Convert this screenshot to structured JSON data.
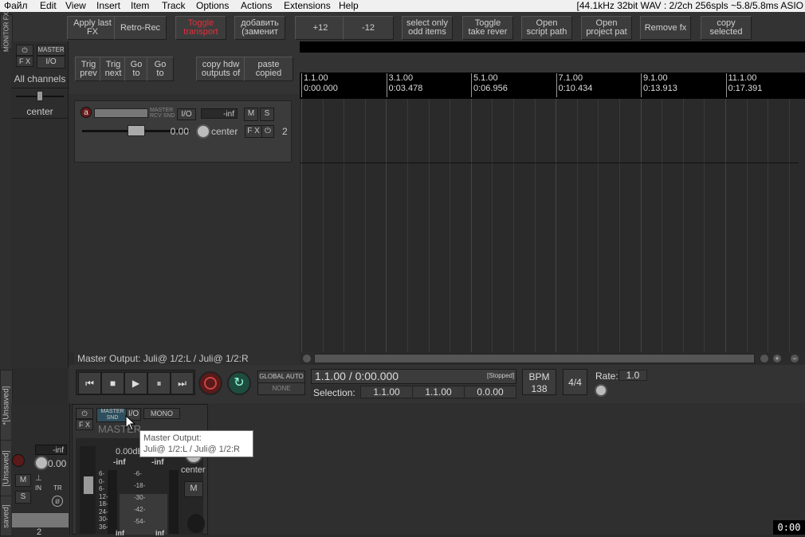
{
  "menu": {
    "items": [
      "Файл",
      "Edit",
      "View",
      "Insert",
      "Item",
      "Track",
      "Options",
      "Actions",
      "Extensions",
      "Help"
    ],
    "status": "[44.1kHz 32bit WAV : 2/2ch 256spls ~5.8/5.8ms ASIO"
  },
  "toolbar": {
    "row1": [
      {
        "name": "apply-last-fx-button",
        "label": "Apply last\nFX",
        "red": false
      },
      {
        "name": "retro-rec-button",
        "label": "Retro-Rec",
        "red": false
      },
      {
        "name": "toggle-transport-button",
        "label": "Toggle\ntransport",
        "red": true
      },
      {
        "name": "add-replace-button",
        "label": "добавить\n(заменит",
        "red": false
      },
      {
        "name": "plus-12-button",
        "label": "+12",
        "red": false
      },
      {
        "name": "minus-12-button",
        "label": "-12",
        "red": false
      },
      {
        "name": "select-only-odd-items-button",
        "label": "select only\nodd items",
        "red": false
      },
      {
        "name": "toggle-take-rever-button",
        "label": "Toggle\ntake rever",
        "red": false
      },
      {
        "name": "open-script-path-button",
        "label": "Open\nscript path",
        "red": false
      },
      {
        "name": "open-project-path-button",
        "label": "Open\nproject pat",
        "red": false
      },
      {
        "name": "remove-fx-button",
        "label": "Remove fx",
        "red": false
      },
      {
        "name": "copy-selected-button",
        "label": "copy\nselected",
        "red": false
      }
    ],
    "row2": [
      {
        "name": "trig-prev-button",
        "label": "Trig\nprev"
      },
      {
        "name": "trig-next-button",
        "label": "Trig\nnext"
      },
      {
        "name": "go-to-1-button",
        "label": "Go\nto"
      },
      {
        "name": "go-to-2-button",
        "label": "Go\nto"
      },
      {
        "name": "copy-hdw-outputs-button",
        "label": "copy hdw\noutputs of"
      },
      {
        "name": "paste-copied-button",
        "label": "paste\ncopied"
      }
    ]
  },
  "monitor": {
    "side_label": "MONITOR FX",
    "fx_label": "F X",
    "master_label": "MASTER",
    "io_label": "I/O",
    "all_channels": "All channels",
    "pan_label": "center"
  },
  "track": {
    "rec_label": "a",
    "master_send": "MASTER\nRCV SND",
    "io_label": "I/O",
    "volume_db": "-inf",
    "mute": "M",
    "solo": "S",
    "volume_value": "0.00",
    "pan_label": "center",
    "fx_label": "F X",
    "track_number": "2"
  },
  "master_output_bar": "Master Output:   Juli@ 1/2:L / Juli@ 1/2:R",
  "ruler": {
    "marks": [
      {
        "bar": "1.1.00",
        "time": "0:00.000"
      },
      {
        "bar": "3.1.00",
        "time": "0:03.478"
      },
      {
        "bar": "5.1.00",
        "time": "0:06.956"
      },
      {
        "bar": "7.1.00",
        "time": "0:10.434"
      },
      {
        "bar": "9.1.00",
        "time": "0:13.913"
      },
      {
        "bar": "11.1.00",
        "time": "0:17.391"
      }
    ]
  },
  "transport": {
    "global_auto": "GLOBAL AUTO",
    "none": "NONE",
    "position": "1.1.00 / 0:00.000",
    "state": "[Stopped]",
    "selection_label": "Selection:",
    "sel_start": "1.1.00",
    "sel_end": "1.1.00",
    "sel_length": "0.0.00",
    "bpm_label": "BPM",
    "bpm": "138",
    "time_sig": "4/4",
    "rate_label": "Rate:",
    "rate": "1.0"
  },
  "mixer": {
    "fx_label": "F X",
    "master_label": "MASTER",
    "snd_label": "SND",
    "io_label": "I/O",
    "mono_label": "MONO",
    "master_title": "MASTER",
    "db_readout": "0.00dB",
    "peak_left": "-inf",
    "peak_right": "-inf",
    "scale": [
      "-6-",
      "-18-",
      "-30-",
      "-42-",
      "-54-"
    ],
    "left_scale": [
      "6-",
      "0-",
      "6-",
      "12-",
      "18-",
      "24-",
      "30-",
      "36-"
    ],
    "bottom_left": "inf",
    "bottom_right": "inf",
    "pan_label": "center",
    "mute": "M",
    "track_vol": "-inf",
    "track_val": "0.00",
    "m_btn": "M",
    "s_btn": "S",
    "in_label": "IN",
    "tr_label": "TR",
    "track_number": "2",
    "tab1": "*[Unsaved]",
    "tab2": "[Unsaved]",
    "tab3": "saved]"
  },
  "tooltip": {
    "line1": "Master Output:",
    "line2": "Juli@ 1/2:L / Juli@ 1/2:R"
  },
  "clock": "0:00"
}
